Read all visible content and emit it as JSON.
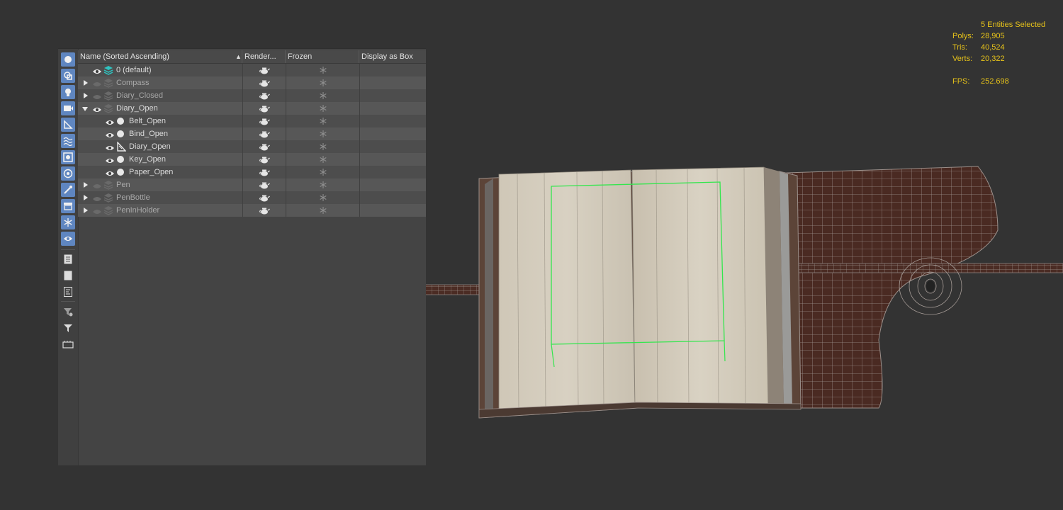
{
  "viewport": {
    "selection": "5 Entities Selected",
    "stats": [
      {
        "label": "Polys:",
        "value": "28,905"
      },
      {
        "label": "Tris:",
        "value": "40,524"
      },
      {
        "label": "Verts:",
        "value": "20,322"
      },
      {
        "label": "FPS:",
        "value": "252.698"
      }
    ],
    "stat_color": "#e6c21a"
  },
  "explorer": {
    "columns": {
      "name": "Name (Sorted Ascending)",
      "render": "Render...",
      "frozen": "Frozen",
      "box": "Display as Box"
    },
    "toolbar_icons": [
      "geometry-filter-icon",
      "shapes-filter-icon",
      "lights-filter-icon",
      "cameras-filter-icon",
      "helpers-filter-icon",
      "spacewarps-filter-icon",
      "groups-filter-icon",
      "xrefs-filter-icon",
      "bones-filter-icon",
      "containers-filter-icon",
      "frozen-filter-icon",
      "hidden-filter-icon",
      "display-all-icon",
      "display-none-icon",
      "invert-display-icon",
      "filter-options-icon",
      "filter-icon",
      "layer-icon"
    ],
    "rows": [
      {
        "label": "0 (default)",
        "level": 0,
        "expander": "none",
        "visible": true,
        "type": "layer-active"
      },
      {
        "label": "Compass",
        "level": 0,
        "expander": "collapsed",
        "visible": false,
        "type": "layer"
      },
      {
        "label": "Diary_Closed",
        "level": 0,
        "expander": "collapsed",
        "visible": false,
        "type": "layer"
      },
      {
        "label": "Diary_Open",
        "level": 0,
        "expander": "expanded",
        "visible": true,
        "type": "layer"
      },
      {
        "label": "Belt_Open",
        "level": 1,
        "expander": "none",
        "visible": true,
        "type": "object"
      },
      {
        "label": "Bind_Open",
        "level": 1,
        "expander": "none",
        "visible": true,
        "type": "object"
      },
      {
        "label": "Diary_Open",
        "level": 1,
        "expander": "none",
        "visible": true,
        "type": "helper"
      },
      {
        "label": "Key_Open",
        "level": 1,
        "expander": "none",
        "visible": true,
        "type": "object"
      },
      {
        "label": "Paper_Open",
        "level": 1,
        "expander": "none",
        "visible": true,
        "type": "object"
      },
      {
        "label": "Pen",
        "level": 0,
        "expander": "collapsed",
        "visible": false,
        "type": "layer"
      },
      {
        "label": "PenBottle",
        "level": 0,
        "expander": "collapsed",
        "visible": false,
        "type": "layer"
      },
      {
        "label": "PenInHolder",
        "level": 0,
        "expander": "collapsed",
        "visible": false,
        "type": "layer"
      }
    ]
  }
}
